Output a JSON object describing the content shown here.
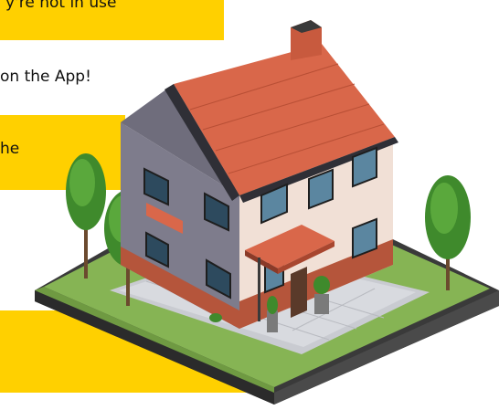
{
  "banners": {
    "top_line": "y're not in use",
    "app_line": "on the App!",
    "short_line": "he"
  },
  "illustration": {
    "icon": "isometric-house-icon",
    "colors": {
      "accent": "#ffd000",
      "roof": "#d9674a",
      "wall_light": "#f1e0d6",
      "wall_dark": "#7e7c8c",
      "brick": "#b5553b",
      "grass": "#86b454",
      "tree": "#3f8a2c"
    }
  }
}
